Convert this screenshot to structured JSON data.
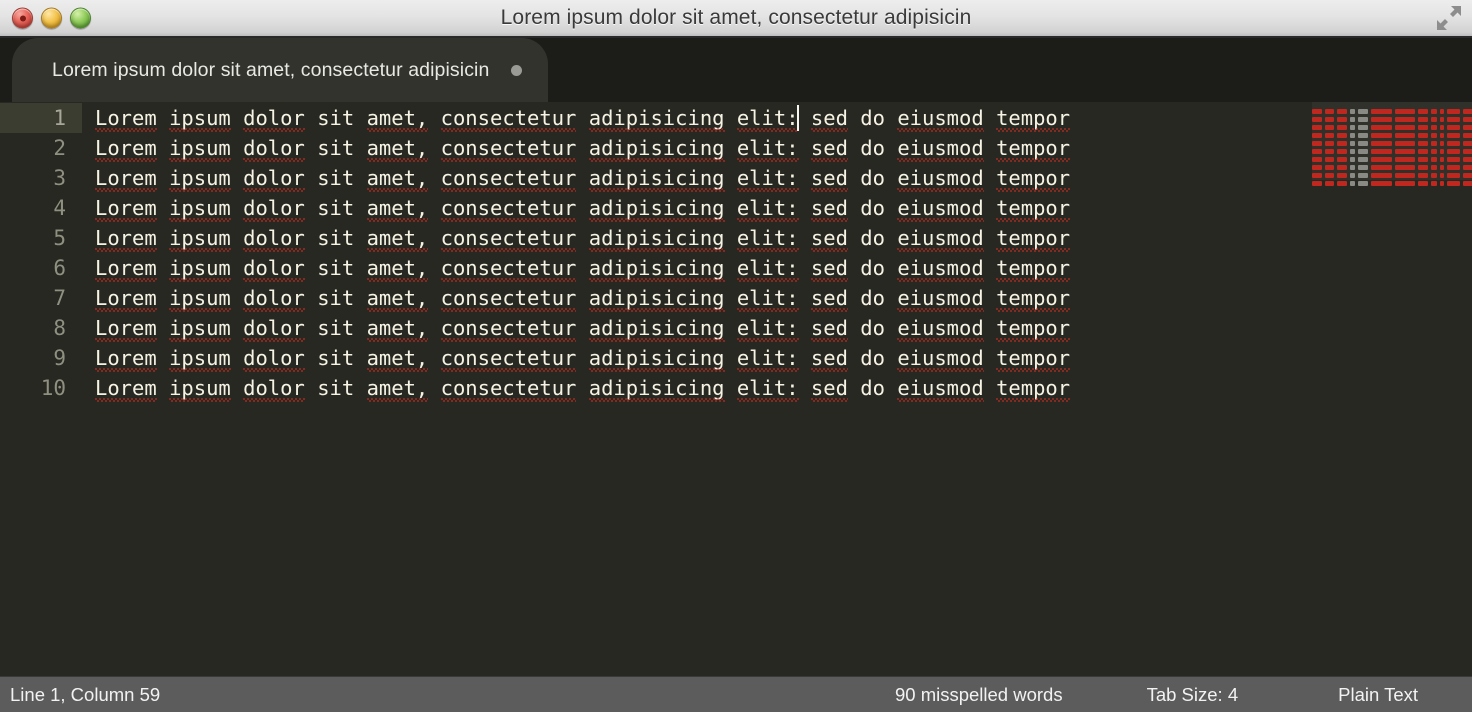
{
  "window": {
    "title": "Lorem ipsum dolor sit amet, consectetur adipisicin",
    "traffic_lights": {
      "close_label": "close",
      "minimize_label": "minimize",
      "maximize_label": "maximize"
    },
    "fullscreen_icon": "fullscreen-expand-icon"
  },
  "tabbar": {
    "tabs": [
      {
        "label": "Lorem ipsum dolor sit amet, consectetur adipisicin",
        "dirty": true,
        "dirty_indicator": "unsaved-dot"
      }
    ]
  },
  "editor": {
    "background_color": "#272822",
    "text_color": "#f6f3e4",
    "active_line_color": "#3c3d31",
    "spellcheck_underline_color": "#e02b20",
    "caret_color": "#f8f8f0",
    "caret_line": 1,
    "caret_column": 59,
    "line_numbers": [
      "1",
      "2",
      "3",
      "4",
      "5",
      "6",
      "7",
      "8",
      "9",
      "10"
    ],
    "lines": [
      "Lorem ipsum dolor sit amet, consectetur adipisicing elit: sed do eiusmod tempor",
      "Lorem ipsum dolor sit amet, consectetur adipisicing elit: sed do eiusmod tempor",
      "Lorem ipsum dolor sit amet, consectetur adipisicing elit: sed do eiusmod tempor",
      "Lorem ipsum dolor sit amet, consectetur adipisicing elit: sed do eiusmod tempor",
      "Lorem ipsum dolor sit amet, consectetur adipisicing elit: sed do eiusmod tempor",
      "Lorem ipsum dolor sit amet, consectetur adipisicing elit: sed do eiusmod tempor",
      "Lorem ipsum dolor sit amet, consectetur adipisicing elit: sed do eiusmod tempor",
      "Lorem ipsum dolor sit amet, consectetur adipisicing elit: sed do eiusmod tempor",
      "Lorem ipsum dolor sit amet, consectetur adipisicing elit: sed do eiusmod tempor",
      "Lorem ipsum dolor sit amet, consectetur adipisicing elit: sed do eiusmod tempor"
    ],
    "misspelled_words": [
      "Lorem",
      "ipsum",
      "dolor",
      "amet",
      "consectetur",
      "adipisicing",
      "elit",
      "sed",
      "eiusmod",
      "tempor"
    ]
  },
  "minimap": {
    "visible": true,
    "line_count": 10,
    "highlight_color": "#c0281f",
    "dim_color": "#8a8a84"
  },
  "statusbar": {
    "position": "Line 1, Column 59",
    "spellcheck": "90 misspelled words",
    "tab_size": "Tab Size: 4",
    "syntax": "Plain Text"
  }
}
